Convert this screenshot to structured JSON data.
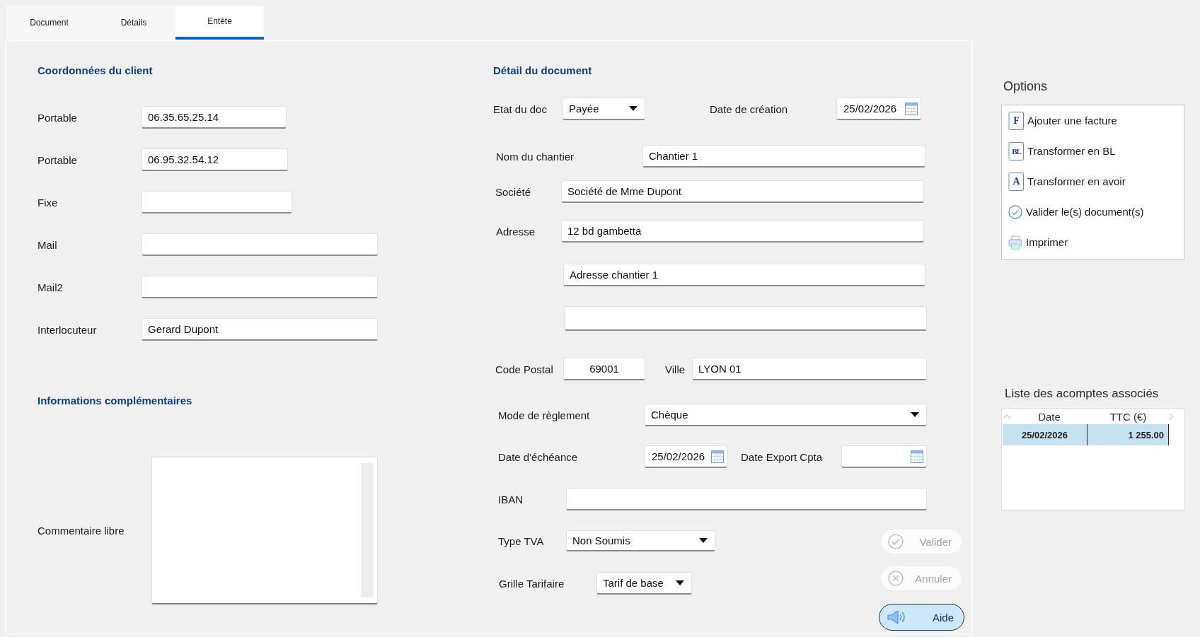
{
  "tabs": [
    {
      "label": "Document",
      "selected": false
    },
    {
      "label": "Détails",
      "selected": false
    },
    {
      "label": "Entête",
      "selected": true
    }
  ],
  "client": {
    "title": "Coordonnées du client",
    "fields": [
      {
        "label": "Portable",
        "value": "06.35.65.25.14"
      },
      {
        "label": "Portable",
        "value": "06.95.32.54.12"
      },
      {
        "label": "Fixe"
      },
      {
        "label": "Mail"
      },
      {
        "label": "Mail2"
      },
      {
        "label": "Interlocuteur",
        "value": "Gerard Dupont"
      }
    ]
  },
  "additional": {
    "title": "Informations complémentaires",
    "comment_label": "Commentaire libre"
  },
  "document": {
    "title": "Détail du document",
    "rows": [
      {
        "fields": [
          {
            "kind": "select",
            "label": "Etat du doc",
            "value": "Payée"
          },
          {
            "kind": "date",
            "label": "Date de création",
            "value": "25/02/2026"
          }
        ]
      },
      {
        "fields": [
          {
            "kind": "text",
            "label": "Nom du chantier",
            "value": "Chantier 1"
          }
        ]
      },
      {
        "fields": [
          {
            "kind": "text",
            "label": "Société",
            "value": "Société de Mme Dupont"
          }
        ]
      },
      {
        "fields": [
          {
            "kind": "text",
            "label": "Adresse",
            "value": "12 bd gambetta"
          }
        ]
      },
      {
        "fields": [
          {
            "kind": "text",
            "value": "Adresse chantier 1"
          }
        ]
      },
      {
        "fields": [
          {
            "kind": "text"
          }
        ]
      },
      {
        "fields": [
          {
            "kind": "text",
            "label": "Code Postal",
            "value": "69001"
          },
          {
            "kind": "text",
            "label": "Ville",
            "value": "LYON 01"
          }
        ]
      },
      {
        "fields": [
          {
            "kind": "select",
            "label": "Mode de règlement",
            "value": "Chèque"
          }
        ]
      },
      {
        "fields": [
          {
            "kind": "date",
            "label": "Date d'échéance",
            "value": "25/02/2026"
          },
          {
            "kind": "date",
            "label": "Date Export Cpta"
          }
        ]
      },
      {
        "fields": [
          {
            "kind": "text",
            "label": "IBAN"
          }
        ]
      },
      {
        "fields": [
          {
            "kind": "select",
            "label": "Type TVA",
            "value": "Non Soumis"
          }
        ]
      },
      {
        "fields": [
          {
            "kind": "select",
            "label": "Grille Tarifaire",
            "value": "Tarif de base"
          }
        ]
      }
    ]
  },
  "actions": [
    {
      "kind": "validate",
      "label": "Valider",
      "disabled": true,
      "focused": false
    },
    {
      "kind": "cancel",
      "label": "Annuler",
      "disabled": true,
      "focused": false
    },
    {
      "kind": "help",
      "label": "Aide",
      "disabled": false,
      "focused": true
    }
  ],
  "options": {
    "title": "Options",
    "items": [
      {
        "kind": "document",
        "badge": "F",
        "label": "Ajouter une facture"
      },
      {
        "kind": "document",
        "badge": "BL",
        "label": "Transformer en BL"
      },
      {
        "kind": "document",
        "badge": "A",
        "label": "Transformer en avoir"
      },
      {
        "kind": "validate",
        "label": "Valider le(s) document(s)"
      },
      {
        "kind": "print",
        "label": "Imprimer"
      }
    ]
  },
  "deposits": {
    "title": "Liste des acomptes associés",
    "columns": [
      "Date",
      "TTC (€)"
    ],
    "rows": [
      {
        "cells": [
          "25/02/2026",
          "1 255.00"
        ],
        "selected": true
      }
    ]
  }
}
